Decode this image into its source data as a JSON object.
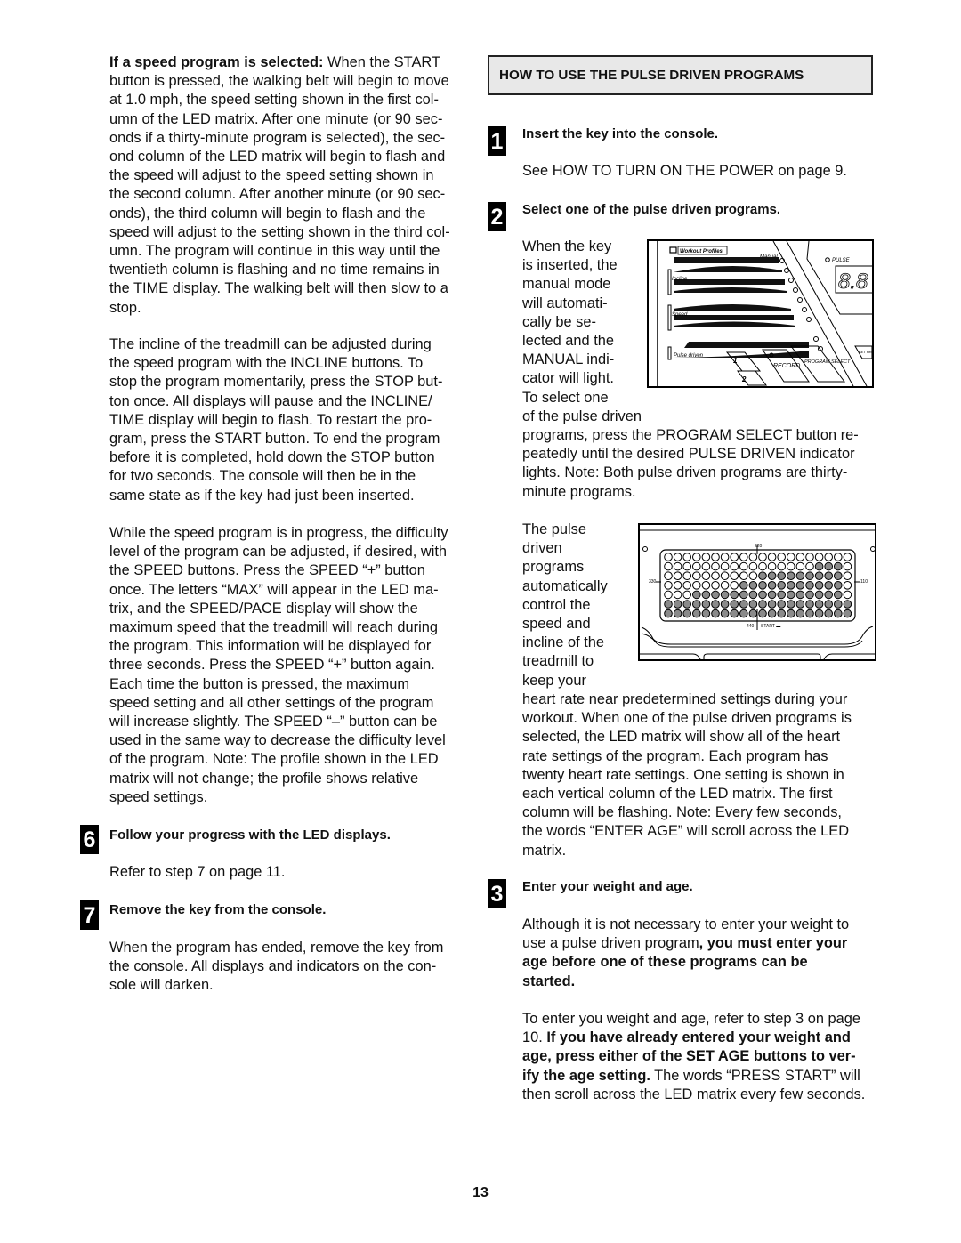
{
  "page_number": "13",
  "left": {
    "speed_program": {
      "lead": "If a speed program is selected:",
      "lines": [
        " When the START",
        "button is pressed, the walking belt will begin to move",
        "at 1.0 mph, the speed setting shown in the first col-",
        "umn of the LED matrix. After one minute (or 90 sec-",
        "onds if a thirty-minute program is selected), the sec-",
        "ond column of the LED matrix will begin to flash and",
        "the speed will adjust to the speed setting shown in",
        "the second column. After another minute (or 90 sec-",
        "onds), the third column will begin to flash and the",
        "speed will adjust to the setting shown in the third col-",
        "umn. The program will continue in this way until the",
        "twentieth column is flashing and no time remains in",
        "the TIME display. The walking belt will then slow to a",
        "stop."
      ]
    },
    "incline_paragraph": [
      "The incline of the treadmill can be adjusted during",
      "the speed program with the INCLINE buttons. To",
      "stop the program momentarily, press the STOP but-",
      "ton once. All displays will pause and the INCLINE/",
      "TIME display will begin to flash. To restart the pro-",
      "gram, press the START button. To end the program",
      "before it is completed, hold down the STOP button",
      "for two seconds. The console will then be in the",
      "same state as if the key had just been inserted."
    ],
    "difficulty_paragraph": [
      "While the speed program is in progress, the difficulty",
      "level of the program can be adjusted, if desired, with",
      "the SPEED buttons. Press the SPEED “+” button",
      "once. The letters “MAX” will appear in the LED ma-",
      "trix, and the SPEED/PACE display will show the",
      "maximum speed that the treadmill will reach during",
      "the program. This information will be displayed for",
      "three seconds. Press the SPEED “+” button again.",
      "Each time the button is pressed, the maximum",
      "speed setting and all other settings of the program",
      "will increase slightly. The SPEED “–” button can be",
      "used in the same way to decrease the difficulty level",
      "of the program. Note: The profile shown in the LED",
      "matrix will not change; the profile shows relative",
      "speed settings."
    ],
    "step6": {
      "number": "6",
      "heading": "Follow your progress with the LED displays.",
      "body": "Refer to step 7 on page 11."
    },
    "step7": {
      "number": "7",
      "heading": "Remove the key from the console.",
      "lines": [
        "When the program has ended, remove the key from",
        "the console. All displays and indicators on the con-",
        "sole will darken."
      ]
    }
  },
  "right": {
    "section_title": "HOW TO USE THE PULSE DRIVEN PROGRAMS",
    "step1": {
      "number": "1",
      "heading": "Insert the key into the console.",
      "body": "See HOW TO TURN ON THE POWER on page 9."
    },
    "step2": {
      "number": "2",
      "heading": "Select one of the pulse driven programs.",
      "wrap_lines": [
        "When the key",
        "is inserted, the",
        "manual mode",
        "will automati-",
        "cally be se-",
        "lected and the",
        "MANUAL indi-",
        "cator will light.",
        "To select one",
        "of the pulse driven"
      ],
      "full_lines": [
        "programs, press the PROGRAM SELECT button re-",
        "peatedly until the desired PULSE DRIVEN indicator",
        "lights. Note: Both pulse driven programs are thirty-",
        "minute programs."
      ],
      "wrap_lines_2": [
        "The pulse",
        "driven",
        "programs",
        "automatically",
        "control the",
        "speed and",
        "incline of the",
        "treadmill to",
        "keep your"
      ],
      "full_lines_2": [
        "heart rate near predetermined settings during your",
        "workout. When one of the pulse driven programs is",
        "selected, the LED matrix will show all of the heart",
        "rate settings of the program. Each program has",
        "twenty heart rate settings. One setting is shown in",
        "each vertical column of the LED matrix. The first",
        "column will be flashing. Note: Every few seconds,",
        "the words “ENTER AGE” will scroll across the LED",
        "matrix."
      ]
    },
    "step3": {
      "number": "3",
      "heading": "Enter your weight and age.",
      "para1": [
        [
          {
            "t": "Although it is not necessary to enter your weight to",
            "b": false
          }
        ],
        [
          {
            "t": "use a pulse driven program",
            "b": false
          },
          {
            "t": ", you must enter your",
            "b": true
          }
        ],
        [
          {
            "t": "age before one of these programs can be",
            "b": true
          }
        ],
        [
          {
            "t": "started.",
            "b": true
          }
        ]
      ],
      "para2": [
        [
          {
            "t": "To enter you weight and age, refer to step 3 on page",
            "b": false
          }
        ],
        [
          {
            "t": "10. ",
            "b": false
          },
          {
            "t": "If you have already entered your weight and",
            "b": true
          }
        ],
        [
          {
            "t": "age, press either of the SET AGE buttons to ver-",
            "b": true
          }
        ],
        [
          {
            "t": "ify the age setting.",
            "b": true
          },
          {
            "t": " The words “PRESS START” will",
            "b": false
          }
        ],
        [
          {
            "t": "then scroll across the LED matrix every few seconds.",
            "b": false
          }
        ]
      ]
    }
  },
  "console_figure": {
    "workout_profiles_label": "Workout Profiles",
    "manual_label": "Manual",
    "incline_label": "Incline",
    "speed_label": "Speed",
    "pulse_driven_label": "Pulse driven",
    "pulse_indicator_label": "PULSE",
    "display_digits": "8.8",
    "custom1_label": "CUSTOM PROGRAM",
    "custom1_number": "1",
    "custom2_label": "CUSTOM PROGRAM",
    "custom2_number": "2",
    "record_label": "RECORD",
    "record_sub": "CUSTOM PROGRAM",
    "program_select_label": "PROGRAM SELECT",
    "set_label": "SET HR"
  },
  "led_figure": {
    "label_top": "220",
    "label_left": "330",
    "label_right": "110",
    "label_bottom": "440",
    "start_label": "START ▬",
    "column_levels": [
      2,
      2,
      2,
      3,
      3,
      3,
      3,
      3,
      4,
      4,
      5,
      5,
      5,
      5,
      5,
      5,
      6,
      6,
      6,
      2
    ]
  }
}
